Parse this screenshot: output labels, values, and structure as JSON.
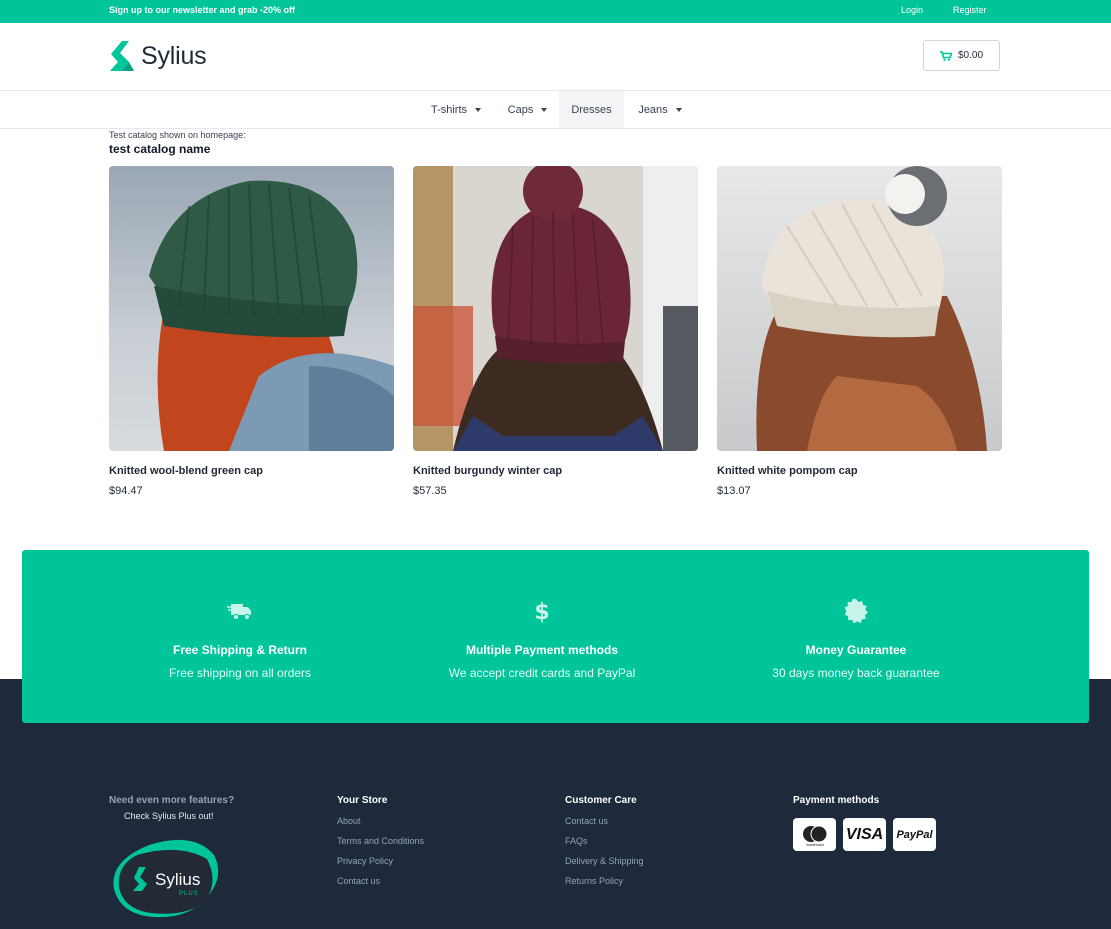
{
  "topbar": {
    "promo": "Sign up to our newsletter and grab -20% off",
    "login": "Login",
    "register": "Register"
  },
  "header": {
    "logo_text": "Sylius",
    "cart_total": "$0.00"
  },
  "nav": {
    "items": [
      {
        "label": "T-shirts",
        "has_dropdown": true
      },
      {
        "label": "Caps",
        "has_dropdown": true
      },
      {
        "label": "Dresses",
        "has_dropdown": false,
        "active": true
      },
      {
        "label": "Jeans",
        "has_dropdown": true
      }
    ]
  },
  "catalog": {
    "note": "Test catalog shown on homepage:",
    "title": "test catalog name",
    "products": [
      {
        "name": "Knitted wool-blend green cap",
        "price": "$94.47"
      },
      {
        "name": "Knitted burgundy winter cap",
        "price": "$57.35"
      },
      {
        "name": "Knitted white pompom cap",
        "price": "$13.07"
      }
    ]
  },
  "features": [
    {
      "icon": "truck-icon",
      "title": "Free Shipping & Return",
      "desc": "Free shipping on all orders"
    },
    {
      "icon": "dollar-icon",
      "title": "Multiple Payment methods",
      "desc": "We accept credit cards and PayPal"
    },
    {
      "icon": "badge-icon",
      "title": "Money Guarantee",
      "desc": "30 days money back guarantee"
    }
  ],
  "footer": {
    "plus": {
      "title": "Need even more features?",
      "subtitle": "Check Sylius Plus out!",
      "logo_text": "Sylius",
      "logo_badge": "PLUS"
    },
    "your_store": {
      "heading": "Your Store",
      "links": [
        "About",
        "Terms and Conditions",
        "Privacy Policy",
        "Contact us"
      ]
    },
    "customer_care": {
      "heading": "Customer Care",
      "links": [
        "Contact us",
        "FAQs",
        "Delivery & Shipping",
        "Returns Policy"
      ]
    },
    "payment": {
      "heading": "Payment methods",
      "cards": [
        "mastercard",
        "VISA",
        "PayPal"
      ]
    }
  },
  "colors": {
    "brand": "#00c49a",
    "footer_bg": "#1e293b"
  }
}
